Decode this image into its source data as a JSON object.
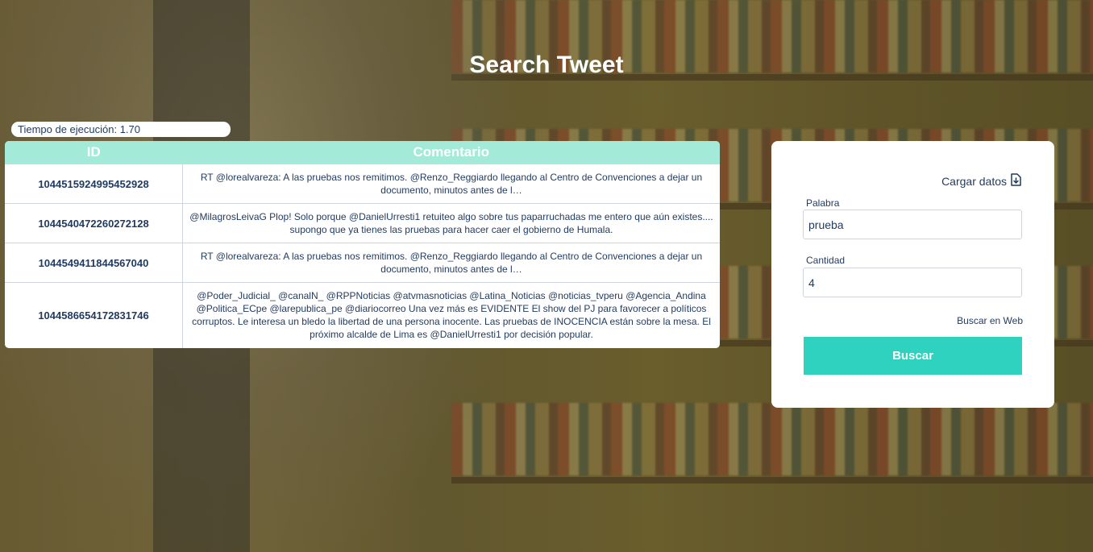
{
  "page": {
    "title": "Search Tweet",
    "execution_time": "Tiempo de ejecución: 1.70"
  },
  "table": {
    "headers": [
      "ID",
      "Comentario"
    ],
    "rows": [
      {
        "id": "1044515924995452928",
        "comment": "RT @lorealvareza: A las pruebas nos remitimos. @Renzo_Reggiardo llegando al Centro de Convenciones a dejar un documento, minutos antes de l…"
      },
      {
        "id": "1044540472260272128",
        "comment": "@MilagrosLeivaG Plop! Solo porque @DanielUrresti1 retuiteo algo sobre tus paparruchadas me entero que aún existes.... supongo que ya tienes las pruebas para hacer caer el gobierno de Humala."
      },
      {
        "id": "1044549411844567040",
        "comment": "RT @lorealvareza: A las pruebas nos remitimos. @Renzo_Reggiardo llegando al Centro de Convenciones a dejar un documento, minutos antes de l…"
      },
      {
        "id": "1044586654172831746",
        "comment": "@Poder_Judicial_ @canalN_ @RPPNoticias @atvmasnoticias @Latina_Noticias @noticias_tvperu @Agencia_Andina @Politica_ECpe @larepublica_pe @diariocorreo Una vez más es EVIDENTE El show del PJ para favorecer a políticos corruptos. Le interesa un bledo la libertad de una persona inocente. Las pruebas de INOCENCIA están sobre la mesa. El próximo alcalde de Lima es @DanielUrresti1 por decisión popular."
      }
    ]
  },
  "panel": {
    "load_label": "Cargar datos",
    "load_icon": "file-download-icon",
    "word_label": "Palabra",
    "word_value": "prueba",
    "amount_label": "Cantidad",
    "amount_value": "4",
    "web_link": "Buscar en Web",
    "search_button": "Buscar"
  },
  "colors": {
    "header_bg": "#a3ead8",
    "button_bg": "#2ed2bf",
    "text": "#1f3a5f"
  }
}
